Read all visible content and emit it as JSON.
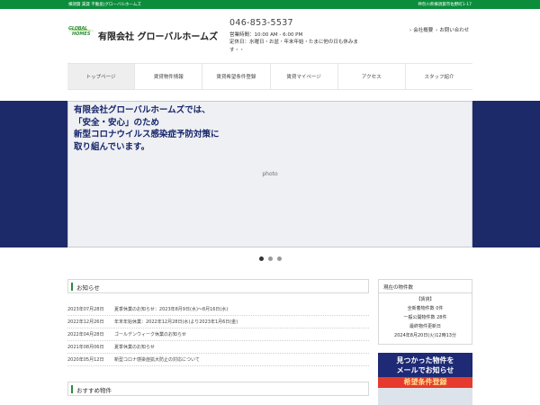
{
  "topbar": {
    "left": "横須賀 賃貸 不動産|グローバルホームズ",
    "right": "神奈川県横須賀市佐野町1-17"
  },
  "header": {
    "logo_line1": "GLOBAL",
    "logo_line2": "HOMES",
    "company": "有限会社 グローバルホームズ",
    "phone": "046-853-5537",
    "hours": "営業時間：10:00 AM - 6:00 PM",
    "holiday": "定休日：水曜日・お盆・年末年始・たまに他の日も休みます・・"
  },
  "toplinks": [
    {
      "label": "会社概要"
    },
    {
      "label": "お問い合わせ"
    }
  ],
  "nav": [
    {
      "label": "トップページ",
      "active": true
    },
    {
      "label": "賃貸物件情報"
    },
    {
      "label": "賃貸希望条件登録"
    },
    {
      "label": "賃貸マイページ"
    },
    {
      "label": "アクセス"
    },
    {
      "label": "スタッフ紹介"
    }
  ],
  "hero": {
    "caption_line1": "有限会社グローバルホームズでは、",
    "caption_line2": "「安全・安心」のため",
    "caption_line3": "新型コロナウイルス感染症予防対策に",
    "caption_line4": "取り組んでいます。"
  },
  "carousel": {
    "count": 3,
    "active": 0
  },
  "news": {
    "heading": "お知らせ",
    "items": [
      {
        "date": "2023年07月28日",
        "text": "夏季休業のお知らせ：2023年8月9日(水)～8月16日(水)"
      },
      {
        "date": "2022年12月26日",
        "text": "年末年始休業：2022年12月28日(水)より2023年1月6日(金)"
      },
      {
        "date": "2022年04月28日",
        "text": "ゴールデンウィーク休業のお知らせ"
      },
      {
        "date": "2021年08月06日",
        "text": "夏季休業のお知らせ"
      },
      {
        "date": "2020年05月12日",
        "text": "新型コロナ感染症拡大防止の対応について"
      }
    ]
  },
  "recommended": {
    "heading": "おすすめ物件"
  },
  "side": {
    "heading": "現在の物件数",
    "line1": "【賃貸】",
    "line2": "全新着物件数 0件",
    "line3": "一般公開物件数 28件",
    "line4": "最終物件更新日",
    "line5": "2024年8月20日(火)12時13分"
  },
  "banner": {
    "line1": "見つかった物件を",
    "line2": "メールでお知らせ",
    "line3": "希望条件登録"
  },
  "colors": {
    "green": "#0c8d3c",
    "navy": "#1d2a69"
  }
}
